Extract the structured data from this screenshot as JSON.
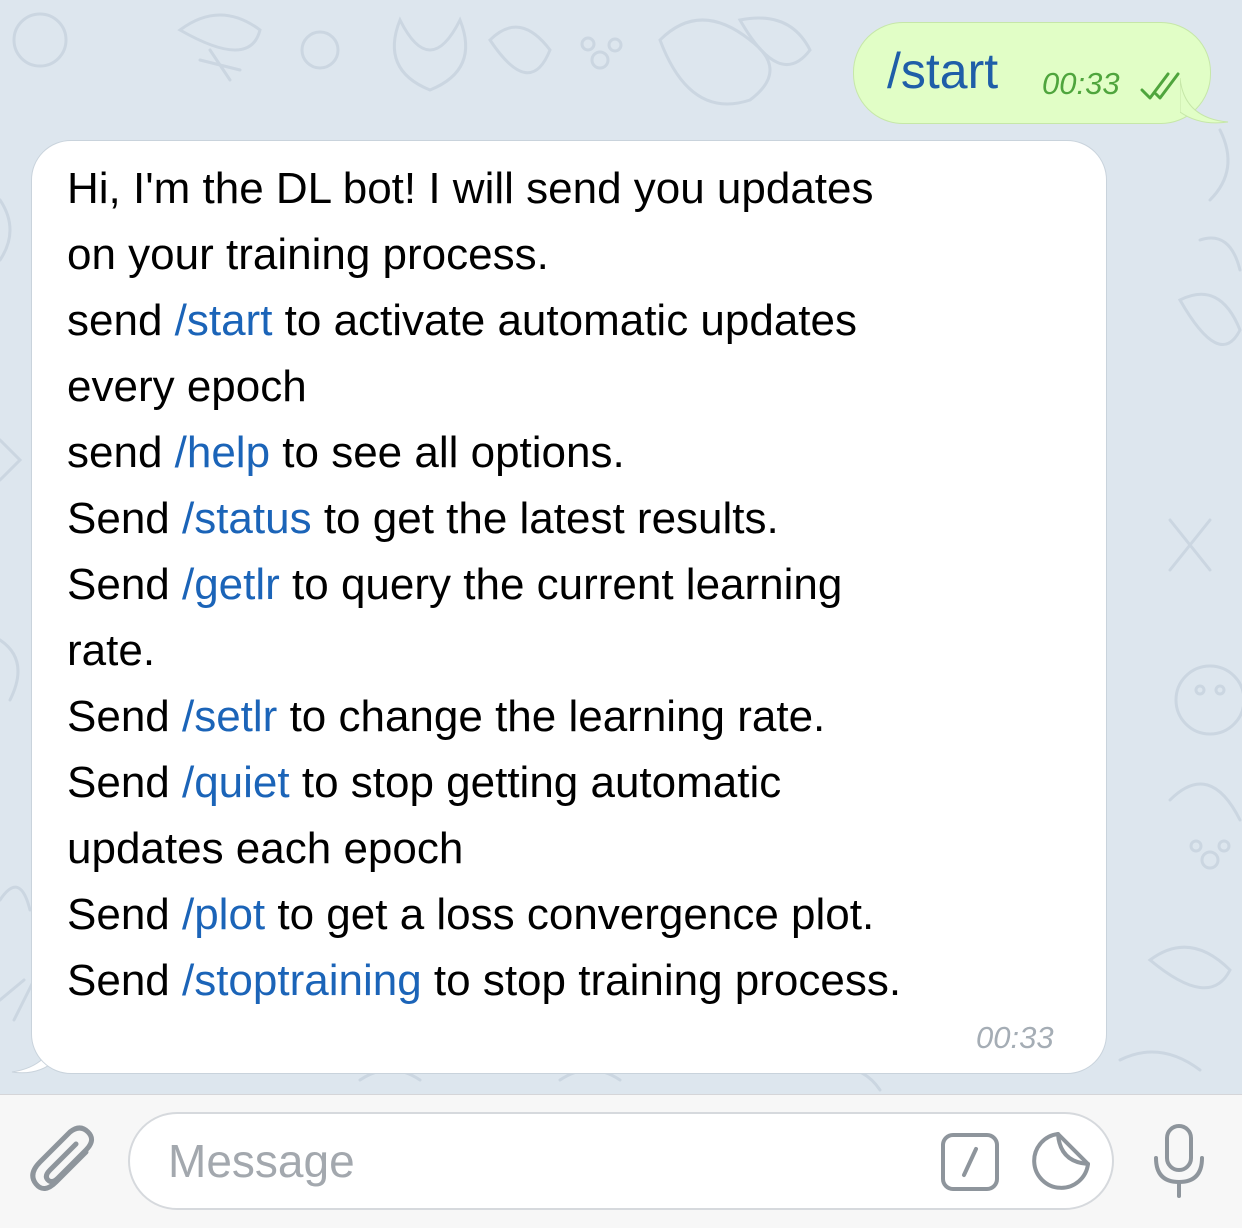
{
  "outgoing": {
    "text": "/start",
    "time": "00:33",
    "status_icon": "double-check-icon",
    "bubble_color": "#e1fec6",
    "text_color": "#1f5ea8",
    "time_color": "#4fa53d"
  },
  "incoming": {
    "lines": [
      {
        "pre": "Hi, I'm the DL bot! I will send you updates",
        "cmd": "",
        "post": ""
      },
      {
        "pre": "on your training process.",
        "cmd": "",
        "post": ""
      },
      {
        "pre": " send ",
        "cmd": "/start",
        "post": " to activate automatic updates"
      },
      {
        "pre": "every epoch",
        "cmd": "",
        "post": ""
      },
      {
        "pre": " send ",
        "cmd": "/help",
        "post": " to see all options."
      },
      {
        "pre": " Send ",
        "cmd": "/status",
        "post": " to get the latest results."
      },
      {
        "pre": " Send ",
        "cmd": "/getlr",
        "post": " to query the current learning"
      },
      {
        "pre": "rate.",
        "cmd": "",
        "post": ""
      },
      {
        "pre": " Send ",
        "cmd": "/setlr",
        "post": " to change the learning rate."
      },
      {
        "pre": " Send ",
        "cmd": "/quiet",
        "post": " to stop getting automatic"
      },
      {
        "pre": "updates each epoch",
        "cmd": "",
        "post": ""
      },
      {
        "pre": " Send ",
        "cmd": "/plot",
        "post": " to get a loss convergence plot."
      },
      {
        "pre": " Send ",
        "cmd": "/stoptraining",
        "post": " to stop training process."
      }
    ],
    "time": "00:33",
    "link_color": "#1b64b8"
  },
  "input_bar": {
    "placeholder": "Message",
    "attach_icon": "paperclip-icon",
    "command_icon": "slash-command-icon",
    "sticker_icon": "sticker-icon",
    "mic_icon": "microphone-icon"
  }
}
